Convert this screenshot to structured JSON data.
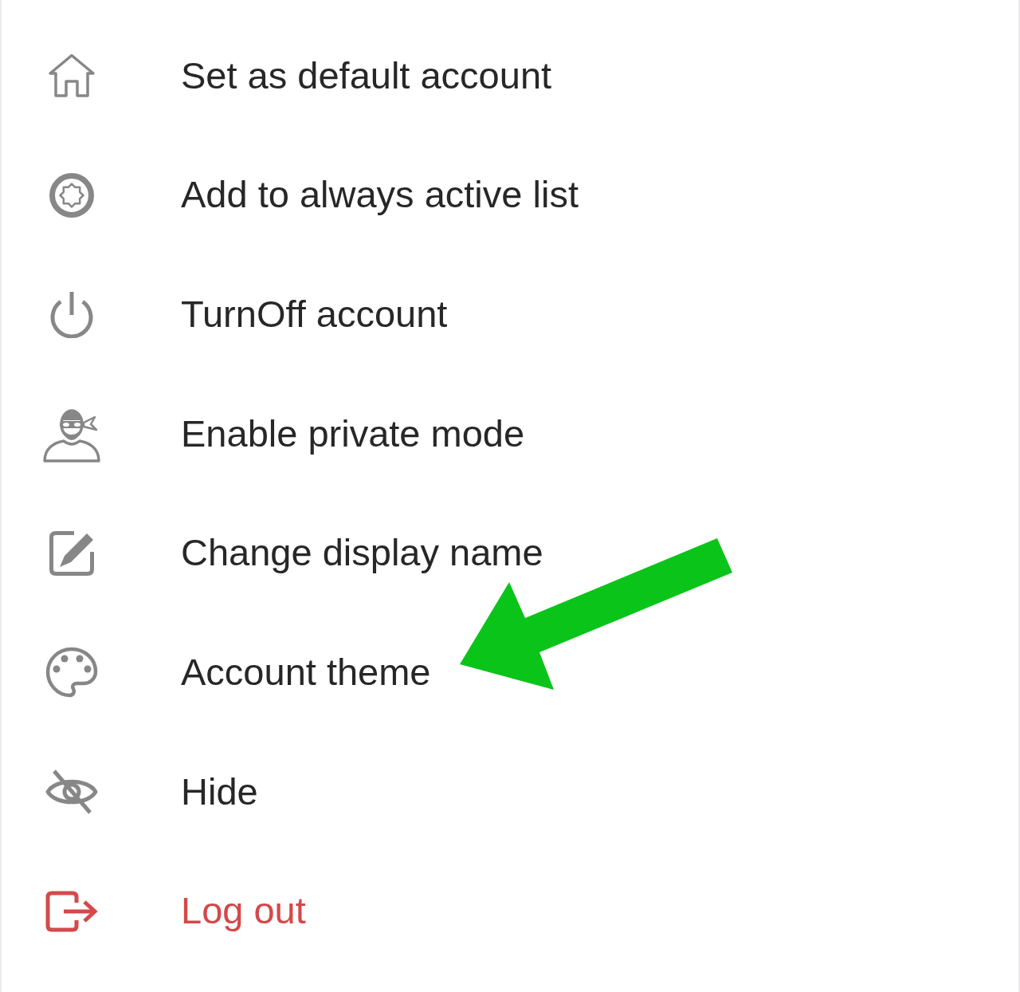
{
  "menu": {
    "items": [
      {
        "label": "Set as default account",
        "kind": "action",
        "pointed_by_arrow": false
      },
      {
        "label": "Add to always active list",
        "kind": "action",
        "pointed_by_arrow": false
      },
      {
        "label": "TurnOff account",
        "kind": "action",
        "pointed_by_arrow": false
      },
      {
        "label": "Enable private mode",
        "kind": "action",
        "pointed_by_arrow": false
      },
      {
        "label": "Change display name",
        "kind": "action",
        "pointed_by_arrow": false
      },
      {
        "label": "Account theme",
        "kind": "action",
        "pointed_by_arrow": true
      },
      {
        "label": "Hide",
        "kind": "action",
        "pointed_by_arrow": false
      },
      {
        "label": "Log out",
        "kind": "danger",
        "pointed_by_arrow": false
      }
    ]
  }
}
